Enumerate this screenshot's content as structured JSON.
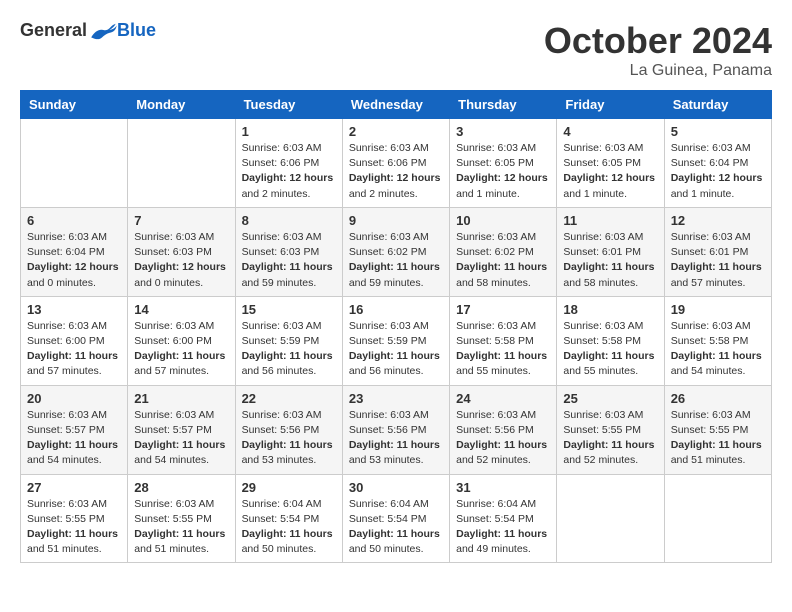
{
  "header": {
    "logo_general": "General",
    "logo_blue": "Blue",
    "month": "October 2024",
    "location": "La Guinea, Panama"
  },
  "days_of_week": [
    "Sunday",
    "Monday",
    "Tuesday",
    "Wednesday",
    "Thursday",
    "Friday",
    "Saturday"
  ],
  "weeks": [
    [
      {
        "day": "",
        "content": ""
      },
      {
        "day": "",
        "content": ""
      },
      {
        "day": "1",
        "content": "Sunrise: 6:03 AM\nSunset: 6:06 PM\nDaylight: 12 hours\nand 2 minutes."
      },
      {
        "day": "2",
        "content": "Sunrise: 6:03 AM\nSunset: 6:06 PM\nDaylight: 12 hours\nand 2 minutes."
      },
      {
        "day": "3",
        "content": "Sunrise: 6:03 AM\nSunset: 6:05 PM\nDaylight: 12 hours\nand 1 minute."
      },
      {
        "day": "4",
        "content": "Sunrise: 6:03 AM\nSunset: 6:05 PM\nDaylight: 12 hours\nand 1 minute."
      },
      {
        "day": "5",
        "content": "Sunrise: 6:03 AM\nSunset: 6:04 PM\nDaylight: 12 hours\nand 1 minute."
      }
    ],
    [
      {
        "day": "6",
        "content": "Sunrise: 6:03 AM\nSunset: 6:04 PM\nDaylight: 12 hours\nand 0 minutes."
      },
      {
        "day": "7",
        "content": "Sunrise: 6:03 AM\nSunset: 6:03 PM\nDaylight: 12 hours\nand 0 minutes."
      },
      {
        "day": "8",
        "content": "Sunrise: 6:03 AM\nSunset: 6:03 PM\nDaylight: 11 hours\nand 59 minutes."
      },
      {
        "day": "9",
        "content": "Sunrise: 6:03 AM\nSunset: 6:02 PM\nDaylight: 11 hours\nand 59 minutes."
      },
      {
        "day": "10",
        "content": "Sunrise: 6:03 AM\nSunset: 6:02 PM\nDaylight: 11 hours\nand 58 minutes."
      },
      {
        "day": "11",
        "content": "Sunrise: 6:03 AM\nSunset: 6:01 PM\nDaylight: 11 hours\nand 58 minutes."
      },
      {
        "day": "12",
        "content": "Sunrise: 6:03 AM\nSunset: 6:01 PM\nDaylight: 11 hours\nand 57 minutes."
      }
    ],
    [
      {
        "day": "13",
        "content": "Sunrise: 6:03 AM\nSunset: 6:00 PM\nDaylight: 11 hours\nand 57 minutes."
      },
      {
        "day": "14",
        "content": "Sunrise: 6:03 AM\nSunset: 6:00 PM\nDaylight: 11 hours\nand 57 minutes."
      },
      {
        "day": "15",
        "content": "Sunrise: 6:03 AM\nSunset: 5:59 PM\nDaylight: 11 hours\nand 56 minutes."
      },
      {
        "day": "16",
        "content": "Sunrise: 6:03 AM\nSunset: 5:59 PM\nDaylight: 11 hours\nand 56 minutes."
      },
      {
        "day": "17",
        "content": "Sunrise: 6:03 AM\nSunset: 5:58 PM\nDaylight: 11 hours\nand 55 minutes."
      },
      {
        "day": "18",
        "content": "Sunrise: 6:03 AM\nSunset: 5:58 PM\nDaylight: 11 hours\nand 55 minutes."
      },
      {
        "day": "19",
        "content": "Sunrise: 6:03 AM\nSunset: 5:58 PM\nDaylight: 11 hours\nand 54 minutes."
      }
    ],
    [
      {
        "day": "20",
        "content": "Sunrise: 6:03 AM\nSunset: 5:57 PM\nDaylight: 11 hours\nand 54 minutes."
      },
      {
        "day": "21",
        "content": "Sunrise: 6:03 AM\nSunset: 5:57 PM\nDaylight: 11 hours\nand 54 minutes."
      },
      {
        "day": "22",
        "content": "Sunrise: 6:03 AM\nSunset: 5:56 PM\nDaylight: 11 hours\nand 53 minutes."
      },
      {
        "day": "23",
        "content": "Sunrise: 6:03 AM\nSunset: 5:56 PM\nDaylight: 11 hours\nand 53 minutes."
      },
      {
        "day": "24",
        "content": "Sunrise: 6:03 AM\nSunset: 5:56 PM\nDaylight: 11 hours\nand 52 minutes."
      },
      {
        "day": "25",
        "content": "Sunrise: 6:03 AM\nSunset: 5:55 PM\nDaylight: 11 hours\nand 52 minutes."
      },
      {
        "day": "26",
        "content": "Sunrise: 6:03 AM\nSunset: 5:55 PM\nDaylight: 11 hours\nand 51 minutes."
      }
    ],
    [
      {
        "day": "27",
        "content": "Sunrise: 6:03 AM\nSunset: 5:55 PM\nDaylight: 11 hours\nand 51 minutes."
      },
      {
        "day": "28",
        "content": "Sunrise: 6:03 AM\nSunset: 5:55 PM\nDaylight: 11 hours\nand 51 minutes."
      },
      {
        "day": "29",
        "content": "Sunrise: 6:04 AM\nSunset: 5:54 PM\nDaylight: 11 hours\nand 50 minutes."
      },
      {
        "day": "30",
        "content": "Sunrise: 6:04 AM\nSunset: 5:54 PM\nDaylight: 11 hours\nand 50 minutes."
      },
      {
        "day": "31",
        "content": "Sunrise: 6:04 AM\nSunset: 5:54 PM\nDaylight: 11 hours\nand 49 minutes."
      },
      {
        "day": "",
        "content": ""
      },
      {
        "day": "",
        "content": ""
      }
    ]
  ]
}
